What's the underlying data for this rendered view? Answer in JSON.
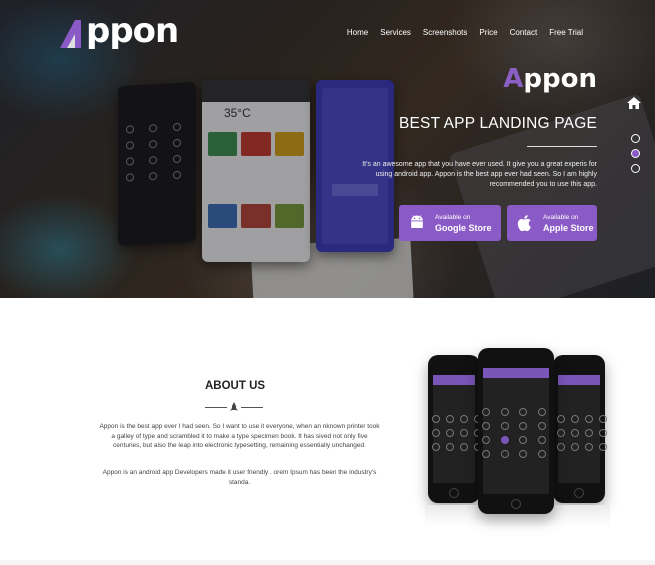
{
  "brand": {
    "logo_text": "ppon",
    "accent": "#8a5bc6"
  },
  "nav": {
    "items": [
      "Home",
      "Services",
      "Screenshots",
      "Price",
      "Contact",
      "Free Trial"
    ]
  },
  "hero": {
    "title_first": "A",
    "title_rest": "ppon",
    "subtitle": "BEST APP LANDING PAGE",
    "description": "It's an awesome app that you have ever used. It give you a great experis for using android app. Appon is the best app ever had seen. So I am highly recommended you to use this app.",
    "phone_temp": "35°C",
    "buttons": {
      "google": {
        "small": "Available on",
        "big": "Google Store"
      },
      "apple": {
        "small": "Available on",
        "big": "Apple Store"
      }
    }
  },
  "about": {
    "title": "ABOUT US",
    "p1": "Appon is the best app ever I had seen. So I want to use it everyone, when an nknown printer took a galley of type and scrambled it to make a type specimen book. It has sived not only five centuries, but also the leap into electronic typesetting, remaining essentially unchanged.",
    "p2": "Appon is an android app Developers made it user friendly . orem Ipsum has been the industry's standa."
  },
  "icons": {
    "home": "home-icon",
    "android": "android-icon",
    "apple": "apple-icon",
    "divider": "rocket-icon"
  },
  "section_dots": 3,
  "active_dot": 2
}
